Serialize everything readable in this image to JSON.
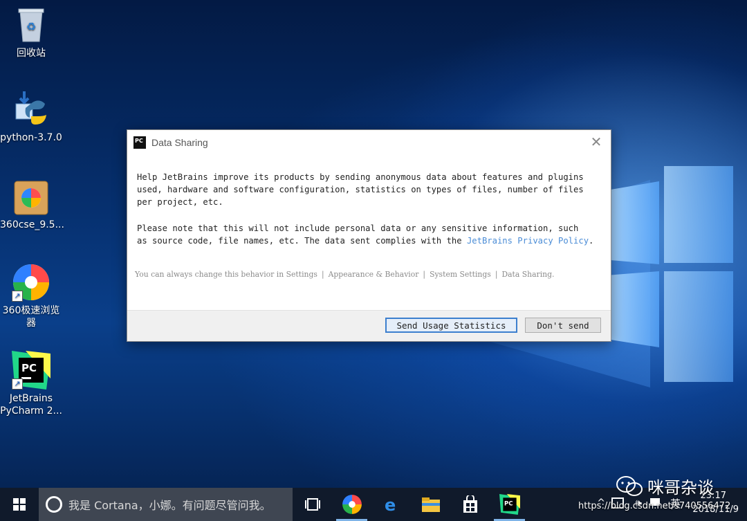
{
  "desktop": {
    "icons": [
      {
        "label": "回收站"
      },
      {
        "label": "python-3.7.0"
      },
      {
        "label": "360cse_9.5..."
      },
      {
        "label": "360极速浏览器"
      },
      {
        "label": "JetBrains PyCharm 2..."
      }
    ]
  },
  "dialog": {
    "title": "Data Sharing",
    "icon": "pycharm-icon",
    "paragraph1": "Help JetBrains improve its products by sending anonymous data about features and plugins\nused, hardware and software configuration, statistics on types of files, number of files\nper project, etc.",
    "paragraph2_pre": "Please note that this will not include personal data or any sensitive information, such\nas source code, file names, etc. The data sent complies with the ",
    "paragraph2_link": "JetBrains Privacy Policy",
    "paragraph2_post": ".",
    "note_parts": [
      "You can always change this behavior in Settings",
      "Appearance & Behavior",
      "System Settings",
      "Data Sharing."
    ],
    "send_button": "Send Usage Statistics",
    "dont_button": "Don't send"
  },
  "taskbar": {
    "search_placeholder": "我是 Cortana，小娜。有问题尽管问我。",
    "apps": [
      "task-view-icon",
      "360-browser-icon",
      "edge-icon",
      "file-explorer-icon",
      "store-icon",
      "pycharm-icon"
    ],
    "tray": {
      "language": "英",
      "time": "23:17",
      "date": "2018/11/9"
    }
  },
  "watermark": {
    "brand": "咪哥杂谈",
    "url": "https://blog.csdn.net/s740556472"
  },
  "colors": {
    "accent": "#3c7fce",
    "link": "#4a8cd6",
    "taskbar": "#101a2b"
  }
}
